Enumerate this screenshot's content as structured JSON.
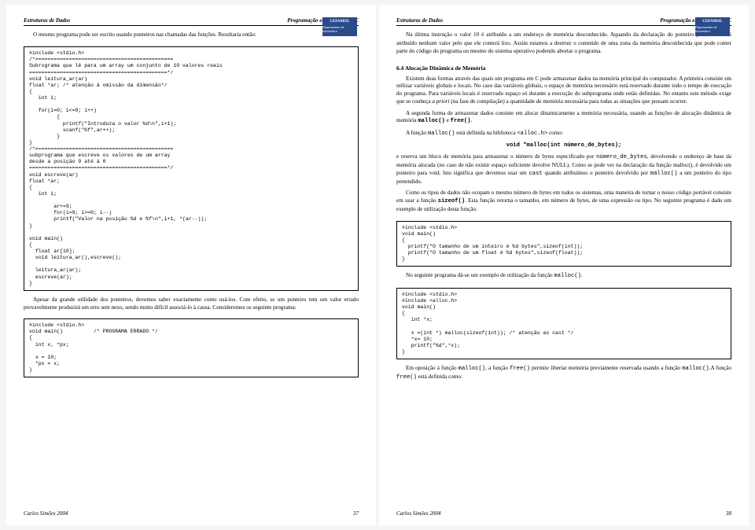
{
  "header": {
    "left": "Estruturas de Dados",
    "right": "Programação em Linguagem C"
  },
  "badge": {
    "name": "CEFAMOL",
    "dept": "Departamento de Informática"
  },
  "footer": {
    "author": "Carlos Simões 2004",
    "pnum_left": "37",
    "pnum_right": "38"
  },
  "left": {
    "intro": "O mesmo programa pode ser escrito usando ponteiros nas chamadas das funções. Resultaria então:",
    "code1": "#include <stdio.h>\n/*=============================================\nSubrograma que lê para um array um conjunto de 10 valores reais\n=============================================*/\nvoid leitura_ar(ar)\nfloat *ar; /* atenção à omissão da dimensão*/\n{\n   int i;\n\n   for(i=0; i<=9; i++)\n         {\n           printf(\"Introduza o valor %d\\n\",i+1);\n           scanf(\"%f\",ar++);\n         }\n}\n/*=============================================\nsubprograma que escreve os valores de um array\ndesde a posição 9 até à 0\n=============================================*/\nvoid escreve(ar)\nfloat *ar;\n{\n   int i;\n\n        ar+=9;\n        for(i=9; i>=0; i--)\n        printf(\"Valor na posição %d e %f\\n\",i+1, *(ar--));\n}\n\nvoid main()\n{\n  float ar[10];\n  void leitura_ar(),escreve();\n\n  leitura_ar(ar);\n  escreve(ar);\n}",
    "warn": "Apesar da grande utilidade dos ponteiros, devemos saber exactamente como usá-los. Com efeito, se um ponteiro tem um valor errado provavelmente produzirá um erro sem nexo, sendo muito difícil associá-lo à causa.  Consideremos os seguinte programa:",
    "code2": "#include <stdio.h>\nvoid main()          /* PROGRAMA ERRADO */\n{\n  int x, *px;\n\n  x = 10;\n  *px = x;\n}"
  },
  "right": {
    "p1a": "Na última instrução o valor 10 é atribuído a um endereço de memória desconhecido. Aquando da declaração do ponteiro ",
    "p1px": "px",
    "p1b": " não lhe foi atribuído nenhum valor pelo que ele conterá lixo. Assim estamos a destruir o conteúdo de uma zona da memória desconhecida que pode conter parte do código do programa ou mesmo do sistema operativo podendo abortar o programa.",
    "sect": "6.4    Alocação Dinâmica de Memória",
    "p2": "Existem duas formas através das quais um programa em C pode armazenar dados na memória principal do computador. A primeira consiste em utilizar variáveis globais e locais. No caso das variáveis globais, o espaço de memória necessário está reservado durante todo o tempo de execução do programa. Para variáveis locais é reservado espaço só durante a execução do subprograma onde estão definidas. No entanto este método exige que se conheça ",
    "p2i": "a priori",
    "p2b": " (na fase de compilação) a quantidade de memória necessária para todas as situações que possam ocorrer.",
    "p3a": "A segunda forma de armazenar dados consiste em alocar dinamicamente a memória necessária, usando as funções de alocação dinâmica de memória ",
    "p3m": "malloc()",
    "p3e": " e ",
    "p3f": "free()",
    "p3dot": ".",
    "p4a": "A função ",
    "p4m": "malloc()",
    "p4b": " está definida na biblioteca ",
    "p4c": "<alloc.h>",
    "p4d": " como:",
    "proto": "void *malloc(int número_de_bytes);",
    "p5a": "e reserva um bloco de memória para armazenar o número de bytes especificado por ",
    "p5m": "número_de_bytes",
    "p5b": ", devolvendo o endereço de base da memória alocada (no caso de não existir espaço suficiente devolve NULL). Como se pode ver na declaração da função malloc(), é devolvido um ponteiro para void. Isto significa que devemos usar um ",
    "p5c": "cast",
    "p5d": " quando atribuímos o ponteiro devolvido por ",
    "p5e": "malloc()",
    "p5f": " a um ponteiro do tipo pretendido.",
    "p6a": "Como os tipos de dados não ocupam o mesmo número de bytes em todos os sistemas, uma maneira de tornar o nosso código portável consiste em usar a função ",
    "p6m": "sizeof()",
    "p6b": ". Esta função retorna o tamanho, em número de bytes, de uma expressão ou tipo. No seguinte programa é dado um exemplo de utilização desta função.",
    "codeA": "#include <stdio.h>\nvoid main()\n{\n  printf(\"O tamanho de um inteiro é %d bytes\",sizeof(int));\n  printf(\"O tamanho de um float é %d bytes\",sizeof(float));\n}",
    "p7a": "No seguinte programa dá-se um exemplo de utilização da função ",
    "p7m": "malloc()",
    "p7b": ".",
    "codeB": "#include <stdio.h>\n#include <alloc.h>\nvoid main()\n{\n   int *x;\n\n   x =(int *) malloc(sizeof(int)); /* atenção ao cast */\n   *x= 10;\n   printf(\"%d\",*x);\n}",
    "p8a": "Em oposição à função ",
    "p8m": "malloc()",
    "p8b": ", a função ",
    "p8f": "free()",
    "p8c": " permite libertar memória previamente reservada usando a função ",
    "p8d": "malloc()",
    "p8e": ".A função ",
    "p8g": "free()",
    "p8h": " está definida como:"
  }
}
